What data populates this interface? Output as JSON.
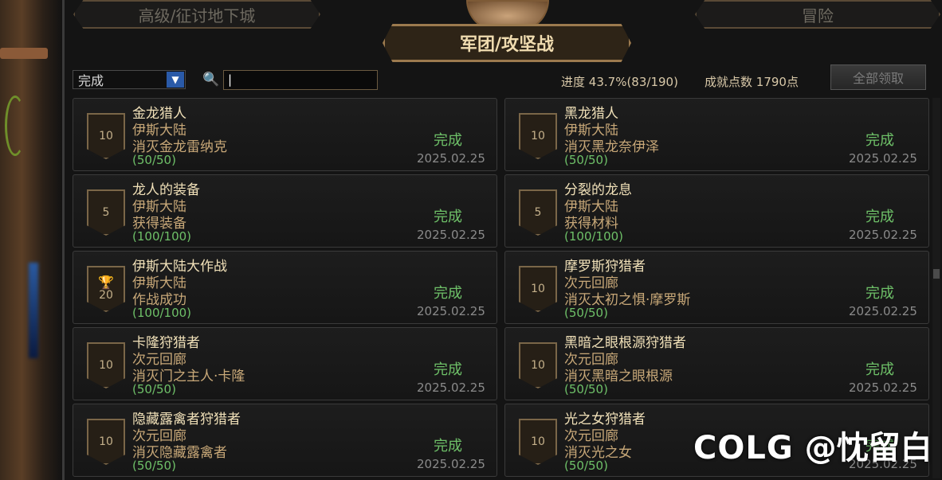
{
  "tabs": {
    "left": "高级/征讨地下城",
    "right": "冒险",
    "active": "军团/攻坚战"
  },
  "filter": {
    "selected": "完成",
    "arrow_icon": "dropdown-arrow-icon"
  },
  "search": {
    "value": "|"
  },
  "stats": {
    "progress_label": "进度",
    "progress_value": "43.7%(83/190)",
    "progress_fraction": 0.437,
    "points_label": "成就点数",
    "points_value": "1790点"
  },
  "claim_all_label": "全部领取",
  "cards": [
    {
      "badge": "10",
      "trophy": false,
      "title": "金龙猎人",
      "region": "伊斯大陆",
      "desc": "消灭金龙雷纳克",
      "count": "(50/50)",
      "status": "完成",
      "date": "2025.02.25"
    },
    {
      "badge": "10",
      "trophy": false,
      "title": "黑龙猎人",
      "region": "伊斯大陆",
      "desc": "消灭黑龙奈伊泽",
      "count": "(50/50)",
      "status": "完成",
      "date": "2025.02.25"
    },
    {
      "badge": "5",
      "trophy": false,
      "title": "龙人的装备",
      "region": "伊斯大陆",
      "desc": "获得装备",
      "count": "(100/100)",
      "status": "完成",
      "date": "2025.02.25"
    },
    {
      "badge": "5",
      "trophy": false,
      "title": "分裂的龙息",
      "region": "伊斯大陆",
      "desc": "获得材料",
      "count": "(100/100)",
      "status": "完成",
      "date": "2025.02.25"
    },
    {
      "badge": "20",
      "trophy": true,
      "title": "伊斯大陆大作战",
      "region": "伊斯大陆",
      "desc": "作战成功",
      "count": "(100/100)",
      "status": "完成",
      "date": "2025.02.25"
    },
    {
      "badge": "10",
      "trophy": false,
      "title": "摩罗斯狩猎者",
      "region": "次元回廊",
      "desc": "消灭太初之惧·摩罗斯",
      "count": "(50/50)",
      "status": "完成",
      "date": "2025.02.25"
    },
    {
      "badge": "10",
      "trophy": false,
      "title": "卡隆狩猎者",
      "region": "次元回廊",
      "desc": "消灭门之主人·卡隆",
      "count": "(50/50)",
      "status": "完成",
      "date": "2025.02.25"
    },
    {
      "badge": "10",
      "trophy": false,
      "title": "黑暗之眼根源狩猎者",
      "region": "次元回廊",
      "desc": "消灭黑暗之眼根源",
      "count": "(50/50)",
      "status": "完成",
      "date": "2025.02.25"
    },
    {
      "badge": "10",
      "trophy": false,
      "title": "隐藏露禽者狩猎者",
      "region": "次元回廊",
      "desc": "消灭隐藏露禽者",
      "count": "(50/50)",
      "status": "完成",
      "date": "2025.02.25"
    },
    {
      "badge": "10",
      "trophy": false,
      "title": "光之女狩猎者",
      "region": "次元回廊",
      "desc": "消灭光之女",
      "count": "(50/50)",
      "status": "完成",
      "date": "2025.02.25"
    }
  ],
  "watermark": {
    "brand": "COLG",
    "author": "@忱留白"
  },
  "colors": {
    "complete_green": "#6ec068",
    "title_gold": "#f0e0b8",
    "accent_bronze": "#9c7a4e"
  }
}
